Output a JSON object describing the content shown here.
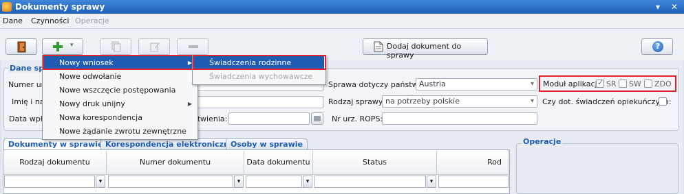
{
  "window": {
    "title": "Dokumenty sprawy"
  },
  "menubar": {
    "items": [
      "Dane",
      "Czynności",
      "Operacje"
    ]
  },
  "toolbar": {
    "add_document_label": "Dodaj dokument do sprawy",
    "help_label": "?"
  },
  "form": {
    "group_title": "Dane spr",
    "labels": {
      "nr": "Numer urz",
      "name": "Imię i naz",
      "date": "Data wpły",
      "rozp": "atwienia:",
      "country": "Sprawa dotyczy państwa:",
      "kind": "Rodzaj sprawy:",
      "rops": "Nr urz. ROPS:",
      "module": "Moduł aplikacji:",
      "care": "Czy dot. świadczeń opiekuńczych:"
    },
    "values": {
      "country": "Austria",
      "kind": "na potrzeby polskie"
    },
    "modules": [
      "SR",
      "SW",
      "ZDO"
    ]
  },
  "menu_main": {
    "items": [
      "Nowy wniosek",
      "Nowe odwołanie",
      "Nowe wszczęcie postępowania",
      "Nowy druk unijny",
      "Nowa korespondencja",
      "Nowe żądanie zwrotu zewnętrzne"
    ]
  },
  "menu_sub": {
    "items": [
      "Świadczenia rodzinne",
      "Świadczenia wychowawcze"
    ]
  },
  "tabs": [
    "Dokumenty w sprawie",
    "Korespondencja elektroniczna",
    "Osoby w sprawie"
  ],
  "grid": {
    "columns": [
      "Rodzaj dokumentu",
      "Numer dokumentu",
      "Data dokumentu",
      "Status",
      "Rod"
    ]
  },
  "operations": {
    "title": "Operacje"
  },
  "colors": {
    "accent": "#1e5cb3",
    "highlight_border": "#e0242f"
  }
}
